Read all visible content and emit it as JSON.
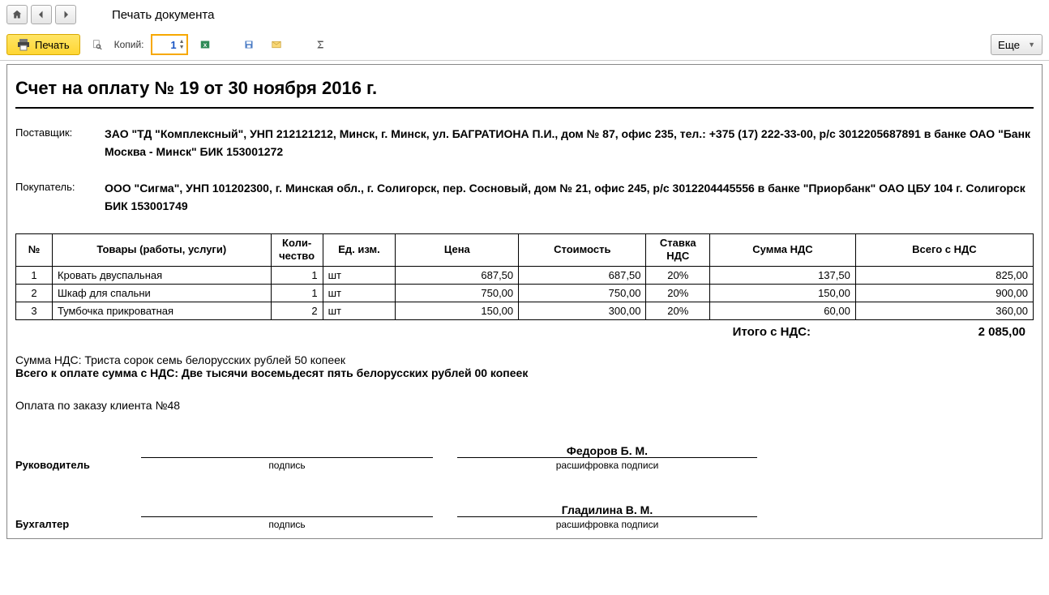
{
  "header": {
    "page_title": "Печать документа"
  },
  "toolbar": {
    "print_label": "Печать",
    "copies_label": "Копий:",
    "copies_value": "1",
    "more_label": "Еще"
  },
  "doc": {
    "title": "Счет на оплату № 19 от 30 ноября 2016  г.",
    "supplier_label": "Поставщик:",
    "supplier": "ЗАО \"ТД \"Комплексный\", УНП 212121212, Минск, г. Минск, ул. БАГРАТИОНА П.И., дом № 87, офис 235, тел.: +375 (17) 222-33-00, р/с 3012205687891 в банке ОАО \"Банк Москва - Минск\" БИК 153001272",
    "buyer_label": "Покупатель:",
    "buyer": "ООО \"Сигма\", УНП 101202300, г. Минская обл., г. Солигорск, пер. Сосновый, дом № 21, офис 245, р/с 3012204445556 в банке \"Приорбанк\" ОАО ЦБУ 104 г. Солигорск БИК 153001749",
    "columns": {
      "num": "№",
      "name": "Товары (работы, услуги)",
      "qty": "Коли-чество",
      "unit": "Ед. изм.",
      "price": "Цена",
      "cost": "Стоимость",
      "vat_rate": "Ставка НДС",
      "vat_sum": "Сумма НДС",
      "total": "Всего с НДС"
    },
    "items": [
      {
        "num": "1",
        "name": "Кровать двуспальная",
        "qty": "1",
        "unit": "шт",
        "price": "687,50",
        "cost": "687,50",
        "vatr": "20%",
        "vats": "137,50",
        "total": "825,00"
      },
      {
        "num": "2",
        "name": "Шкаф для спальни",
        "qty": "1",
        "unit": "шт",
        "price": "750,00",
        "cost": "750,00",
        "vatr": "20%",
        "vats": "150,00",
        "total": "900,00"
      },
      {
        "num": "3",
        "name": "Тумбочка прикроватная",
        "qty": "2",
        "unit": "шт",
        "price": "150,00",
        "cost": "300,00",
        "vatr": "20%",
        "vats": "60,00",
        "total": "360,00"
      }
    ],
    "total_label": "Итого с НДС:",
    "total_value": "2  085,00",
    "vat_words": "Сумма НДС: Триста сорок семь белорусских рублей 50 копеек",
    "total_words": "Всего к оплате сумма с НДС: Две тысячи восемьдесят пять белорусских рублей 00 копеек",
    "order_note": "Оплата по заказу клиента №48",
    "sign": {
      "director_label": "Руководитель",
      "accountant_label": "Бухгалтер",
      "sig_hint": "подпись",
      "name_hint": "расшифровка подписи",
      "director_name": "Федоров Б. М.",
      "accountant_name": "Гладилина В. М."
    }
  }
}
